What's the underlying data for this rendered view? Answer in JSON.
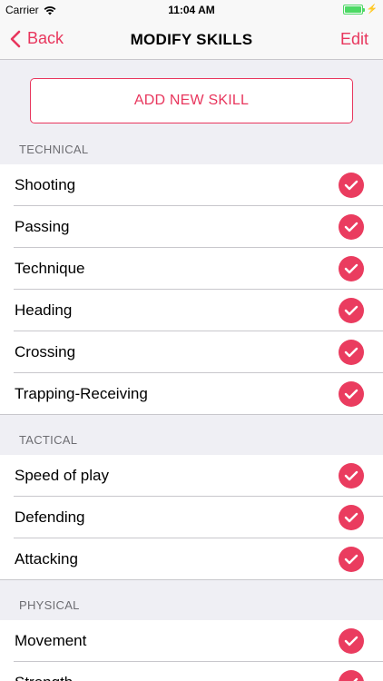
{
  "status_bar": {
    "carrier": "Carrier",
    "time": "11:04 AM"
  },
  "nav": {
    "back_label": "Back",
    "title": "MODIFY SKILLS",
    "edit_label": "Edit"
  },
  "add_button_label": "ADD NEW SKILL",
  "colors": {
    "accent": "#e8365d",
    "check": "#ea3c5f",
    "background": "#efeff4",
    "battery": "#4cd964"
  },
  "sections": [
    {
      "header": "TECHNICAL",
      "items": [
        "Shooting",
        "Passing",
        "Technique",
        "Heading",
        "Crossing",
        "Trapping-Receiving"
      ]
    },
    {
      "header": "TACTICAL",
      "items": [
        "Speed of play",
        "Defending",
        "Attacking"
      ]
    },
    {
      "header": "PHYSICAL",
      "items": [
        "Movement",
        "Strength"
      ]
    }
  ]
}
